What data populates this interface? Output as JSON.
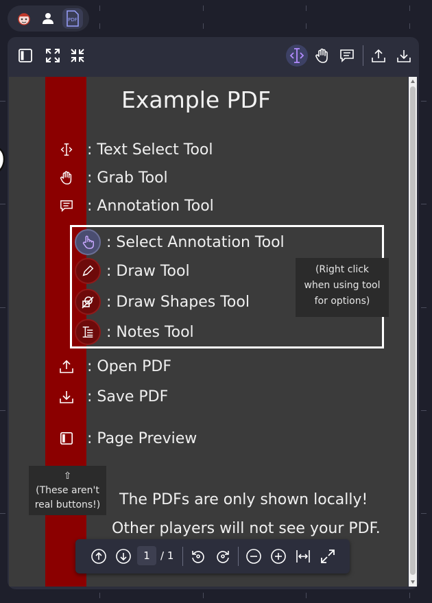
{
  "top_bar": {
    "icons": [
      "mascot-icon",
      "user-icon",
      "pdf-icon"
    ],
    "pdf_label": "PDF"
  },
  "toolbar": {
    "left_icons": [
      "sidebar-toggle-icon",
      "expand-icon",
      "collapse-icon"
    ],
    "right_icons": [
      "text-select-icon",
      "grab-hand-icon",
      "annotation-icon",
      "upload-icon",
      "download-icon"
    ],
    "active_tool": "text-select",
    "accent": "#3d4165"
  },
  "document": {
    "title": "Example PDF",
    "tools": [
      {
        "icon": "text-select-icon",
        "label": ": Text Select Tool"
      },
      {
        "icon": "grab-hand-icon",
        "label": ": Grab Tool"
      },
      {
        "icon": "annotation-icon",
        "label": ": Annotation Tool"
      }
    ],
    "annotation_tools": [
      {
        "icon": "pointer-hand-icon",
        "label": ": Select Annotation Tool"
      },
      {
        "icon": "pencil-icon",
        "label": ": Draw Tool"
      },
      {
        "icon": "shapes-icon",
        "label": ": Draw Shapes Tool"
      },
      {
        "icon": "notes-icon",
        "label": ": Notes Tool"
      }
    ],
    "tooltip_right": [
      "(Right click",
      "when using tool",
      "for options)"
    ],
    "file_tools": [
      {
        "icon": "upload-icon",
        "label": ": Open PDF"
      },
      {
        "icon": "download-icon",
        "label": ": Save PDF"
      },
      {
        "icon": "page-preview-icon",
        "label": ": Page Preview"
      }
    ],
    "tooltip_left_arrow": "⇧",
    "tooltip_left": [
      "(These aren't",
      "real buttons!)"
    ],
    "local_msg_1": "The PDFs are only shown locally!",
    "local_msg_2": "Other players will not see your PDF.",
    "band_color": "#8b0000"
  },
  "pager": {
    "current_page": "1",
    "of_label": "/ 1"
  }
}
